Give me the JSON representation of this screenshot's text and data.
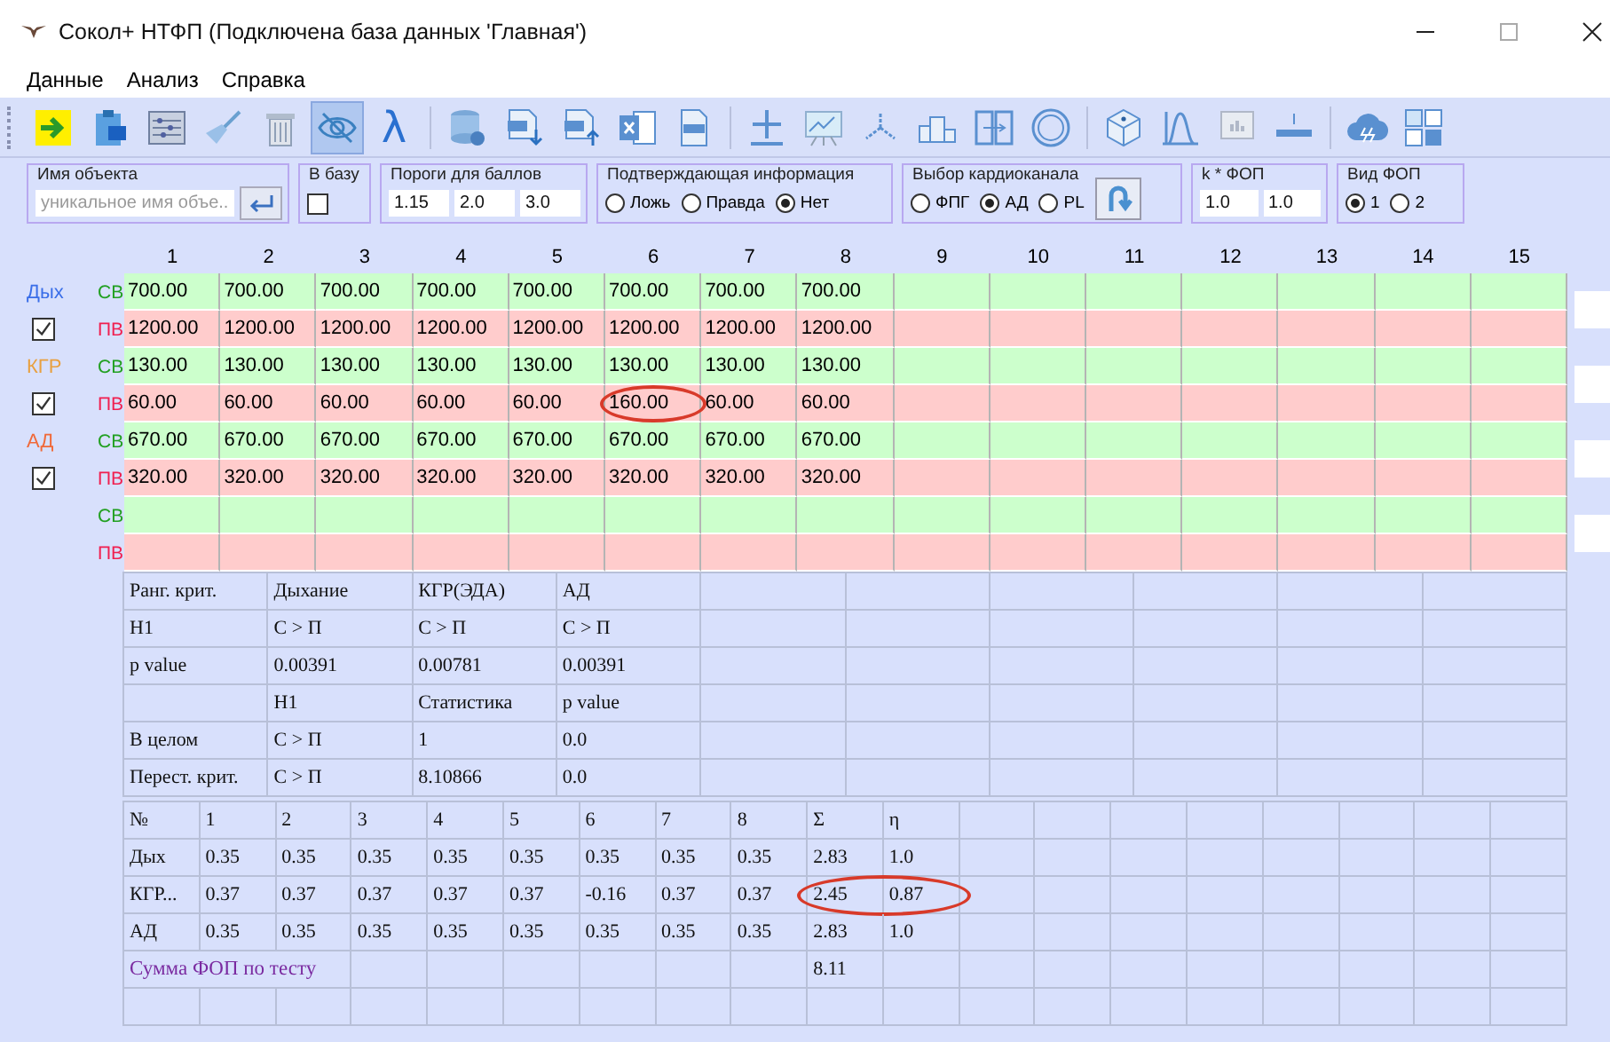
{
  "window": {
    "title": "Сокол+ НТФП (Подключена база данных 'Главная')"
  },
  "menu": [
    "Данные",
    "Анализ",
    "Справка"
  ],
  "toolbar": [
    {
      "buttons": [
        {
          "pressed": false
        },
        {
          "pressed": false
        },
        {
          "pressed": false
        },
        {
          "pressed": false
        },
        {
          "pressed": false
        },
        {
          "pressed": true
        },
        {
          "pressed": false,
          "glyph": "λ"
        }
      ]
    },
    {
      "buttons": [
        {
          "pressed": false
        },
        {
          "pressed": false
        },
        {
          "pressed": false
        },
        {
          "pressed": false
        },
        {
          "pressed": false
        }
      ]
    },
    {
      "buttons": [
        {
          "pressed": false
        },
        {
          "pressed": false
        },
        {
          "pressed": false
        },
        {
          "pressed": false
        },
        {
          "pressed": false
        },
        {
          "pressed": false
        }
      ]
    },
    {
      "buttons": [
        {
          "pressed": false
        },
        {
          "pressed": false
        },
        {
          "pressed": false
        },
        {
          "pressed": false
        }
      ]
    },
    {
      "buttons": [
        {
          "pressed": false
        },
        {
          "pressed": false
        }
      ]
    }
  ],
  "controls": {
    "object_name": {
      "legend": "Имя объекта",
      "placeholder": "уникальное имя объе..."
    },
    "to_base": {
      "legend": "В базу",
      "checked": false
    },
    "thresholds": {
      "legend": "Пороги для баллов",
      "values": [
        "1.15",
        "2.0",
        "3.0"
      ]
    },
    "confirming": {
      "legend": "Подтверждающая информация",
      "options": [
        {
          "label": "Ложь",
          "selected": false
        },
        {
          "label": "Правда",
          "selected": false
        },
        {
          "label": "Нет",
          "selected": true
        }
      ]
    },
    "cardio": {
      "legend": "Выбор кардиоканала",
      "options": [
        {
          "label": "ФПГ",
          "selected": false
        },
        {
          "label": "АД",
          "selected": true
        },
        {
          "label": "PL",
          "selected": false
        }
      ]
    },
    "k_fop": {
      "legend": "k * ФОП",
      "values": [
        "1.0",
        "1.0"
      ]
    },
    "fop_type": {
      "legend": "Вид ФОП",
      "options": [
        {
          "label": "1",
          "selected": true
        },
        {
          "label": "2",
          "selected": false
        }
      ]
    }
  },
  "grid": {
    "columns": [
      "1",
      "2",
      "3",
      "4",
      "5",
      "6",
      "7",
      "8",
      "9",
      "10",
      "11",
      "12",
      "13",
      "14",
      "15"
    ],
    "channels": [
      {
        "name": "Дых",
        "color": "#3a6ee8",
        "checked": true
      },
      {
        "name": "КГР",
        "color": "#e8a040",
        "checked": true
      },
      {
        "name": "АД",
        "color": "#f06a3a",
        "checked": true
      }
    ],
    "rows": [
      {
        "kind": "sv",
        "label": "СВ",
        "cells": [
          "700.00",
          "700.00",
          "700.00",
          "700.00",
          "700.00",
          "700.00",
          "700.00",
          "700.00"
        ]
      },
      {
        "kind": "pv",
        "label": "ПВ",
        "cells": [
          "1200.00",
          "1200.00",
          "1200.00",
          "1200.00",
          "1200.00",
          "1200.00",
          "1200.00",
          "1200.00"
        ]
      },
      {
        "kind": "sv",
        "label": "СВ",
        "cells": [
          "130.00",
          "130.00",
          "130.00",
          "130.00",
          "130.00",
          "130.00",
          "130.00",
          "130.00"
        ]
      },
      {
        "kind": "pv",
        "label": "ПВ",
        "cells": [
          "60.00",
          "60.00",
          "60.00",
          "60.00",
          "60.00",
          {
            "text": "160.00",
            "circled": true
          },
          "60.00",
          "60.00"
        ]
      },
      {
        "kind": "sv",
        "label": "СВ",
        "cells": [
          "670.00",
          "670.00",
          "670.00",
          "670.00",
          "670.00",
          "670.00",
          "670.00",
          "670.00"
        ]
      },
      {
        "kind": "pv",
        "label": "ПВ",
        "cells": [
          "320.00",
          "320.00",
          "320.00",
          "320.00",
          "320.00",
          "320.00",
          "320.00",
          "320.00"
        ]
      },
      {
        "kind": "sv",
        "label": "СВ",
        "cells": []
      },
      {
        "kind": "pv",
        "label": "ПВ",
        "cells": []
      }
    ]
  },
  "criteria_table": {
    "rows": [
      [
        "Ранг. крит.",
        "Дыхание",
        "КГР(ЭДА)",
        "АД"
      ],
      [
        "H1",
        "С > П",
        "С > П",
        "С > П"
      ],
      [
        "p value",
        "0.00391",
        "0.00781",
        "0.00391"
      ],
      [
        null,
        "H1",
        "Статистика",
        "p value"
      ],
      [
        "В целом",
        "С > П",
        "1",
        "0.0"
      ],
      [
        "Перест. крит.",
        "С > П",
        "8.10866",
        "0.0"
      ]
    ]
  },
  "fop_table": {
    "header": [
      "№",
      "1",
      "2",
      "3",
      "4",
      "5",
      "6",
      "7",
      "8",
      "Σ",
      "η"
    ],
    "rows": [
      {
        "kind": "values",
        "cells": [
          "Дых",
          "0.35",
          "0.35",
          "0.35",
          "0.35",
          "0.35",
          "0.35",
          "0.35",
          "0.35",
          "2.83",
          "1.0"
        ]
      },
      {
        "kind": "values",
        "cells": [
          "КГР...",
          "0.37",
          "0.37",
          "0.37",
          "0.37",
          "0.37",
          "-0.16",
          "0.37",
          "0.37",
          {
            "text": "2.45",
            "circled": true
          },
          {
            "text": "0.87",
            "circled": true
          }
        ]
      },
      {
        "kind": "values",
        "cells": [
          "АД",
          "0.35",
          "0.35",
          "0.35",
          "0.35",
          "0.35",
          "0.35",
          "0.35",
          "0.35",
          "2.83",
          "1.0"
        ]
      },
      {
        "kind": "sum",
        "label": "Сумма ФОП по тесту",
        "total": "8.11"
      }
    ]
  }
}
